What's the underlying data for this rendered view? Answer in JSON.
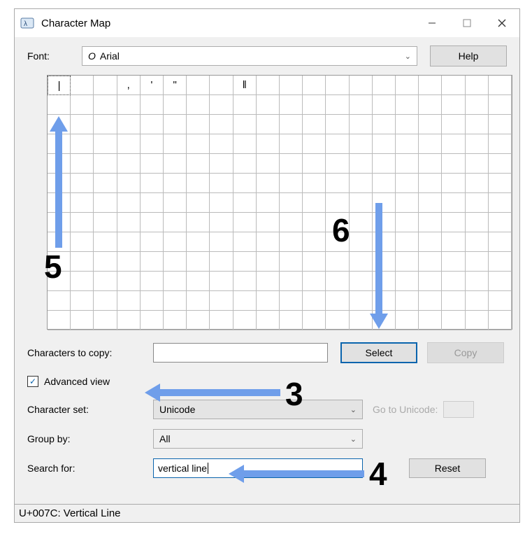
{
  "window": {
    "title": "Character Map"
  },
  "font": {
    "label": "Font:",
    "value": "Arial",
    "prefix": "O"
  },
  "help": {
    "label": "Help"
  },
  "grid": {
    "rows": 13,
    "cols": 20,
    "row0": [
      "|",
      "",
      "",
      ",",
      "'",
      "\"",
      "",
      "",
      "‖",
      "",
      "",
      "",
      "",
      "",
      "",
      "",
      "",
      "",
      "",
      ""
    ]
  },
  "copy": {
    "label": "Characters to copy:",
    "value": "",
    "select_label": "Select",
    "copy_label": "Copy"
  },
  "advanced": {
    "checked": true,
    "label": "Advanced view"
  },
  "charset": {
    "label": "Character set:",
    "value": "Unicode",
    "goto_label": "Go to Unicode:"
  },
  "groupby": {
    "label": "Group by:",
    "value": "All"
  },
  "search": {
    "label": "Search for:",
    "value": "vertical line",
    "reset_label": "Reset"
  },
  "status": {
    "text": "U+007C: Vertical Line"
  },
  "annotations": {
    "n3": "3",
    "n4": "4",
    "n5": "5",
    "n6": "6"
  }
}
